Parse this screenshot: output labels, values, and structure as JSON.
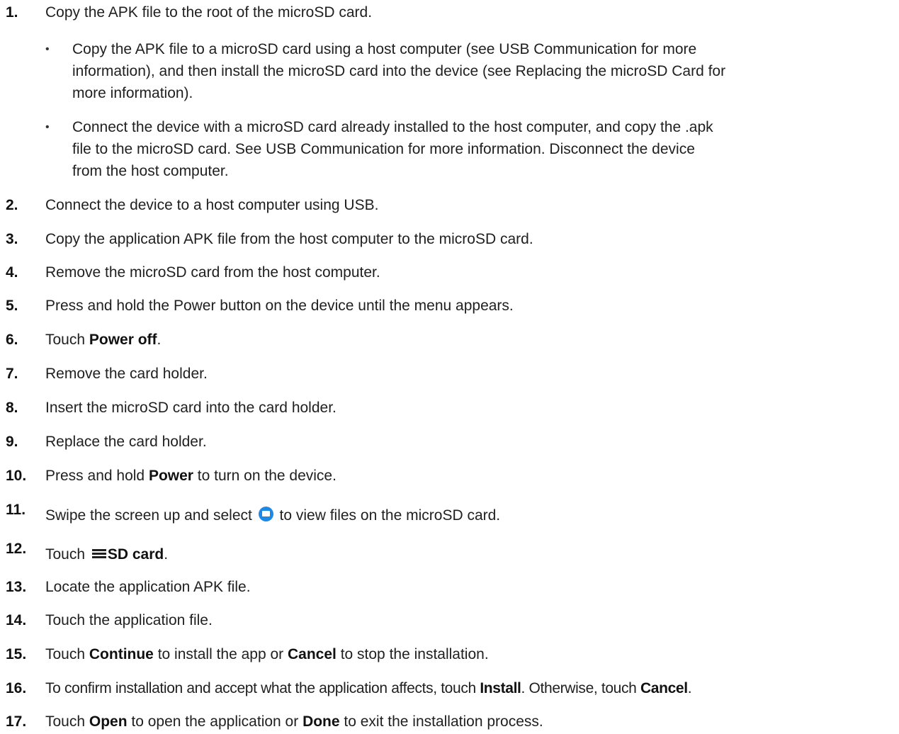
{
  "steps": [
    {
      "num": "1.",
      "parts": [
        {
          "t": "Copy the APK file to the root of the microSD card."
        }
      ]
    },
    {
      "num": "2.",
      "parts": [
        {
          "t": "Connect the device to a host computer using USB."
        }
      ]
    },
    {
      "num": "3.",
      "parts": [
        {
          "t": "Copy the application APK file from the host computer to the microSD card."
        }
      ]
    },
    {
      "num": "4.",
      "parts": [
        {
          "t": "Remove the microSD card from the host computer."
        }
      ]
    },
    {
      "num": "5.",
      "parts": [
        {
          "t": "Press and hold the Power button on the device until the menu appears."
        }
      ]
    },
    {
      "num": "6.",
      "parts": [
        {
          "t": "Touch "
        },
        {
          "b": "Power off"
        },
        {
          "t": "."
        }
      ]
    },
    {
      "num": "7.",
      "parts": [
        {
          "t": "Remove the card holder."
        }
      ]
    },
    {
      "num": "8.",
      "parts": [
        {
          "t": "Insert the microSD card into the card holder."
        }
      ]
    },
    {
      "num": "9.",
      "parts": [
        {
          "t": "Replace the card holder."
        }
      ]
    },
    {
      "num": "10.",
      "parts": [
        {
          "t": "Press and hold "
        },
        {
          "b": "Power"
        },
        {
          "t": " to turn on the device."
        }
      ]
    },
    {
      "num": "11.",
      "parts": [
        {
          "t": "Swipe the screen up and select "
        },
        {
          "icon": "files-app-icon"
        },
        {
          "t": " to view files on the microSD card."
        }
      ]
    },
    {
      "num": "12.",
      "parts": [
        {
          "t": "Touch "
        },
        {
          "icon": "menu-icon"
        },
        {
          "b": "SD card"
        },
        {
          "t": "."
        }
      ]
    },
    {
      "num": "13.",
      "parts": [
        {
          "t": "Locate the application APK file."
        }
      ]
    },
    {
      "num": "14.",
      "parts": [
        {
          "t": "Touch the application file."
        }
      ]
    },
    {
      "num": "15.",
      "parts": [
        {
          "t": "Touch "
        },
        {
          "b": "Continue"
        },
        {
          "t": " to install the app or "
        },
        {
          "b": "Cancel"
        },
        {
          "t": " to stop the installation."
        }
      ]
    },
    {
      "num": "16.",
      "parts": [
        {
          "t": "To confirm installation and accept what the application affects, touch "
        },
        {
          "b": "Install"
        },
        {
          "t": ". Otherwise, touch "
        },
        {
          "b": "Cancel"
        },
        {
          "t": "."
        }
      ]
    },
    {
      "num": "17.",
      "parts": [
        {
          "t": "Touch "
        },
        {
          "b": "Open"
        },
        {
          "t": " to open the application or "
        },
        {
          "b": "Done"
        },
        {
          "t": " to exit the installation process."
        }
      ]
    }
  ],
  "bullets": {
    "marker": "•",
    "items": [
      [
        "Copy the APK file to a microSD card using a host computer (see USB Communication for more",
        "information), and then install the microSD card into the device (see Replacing the microSD Card for",
        "more information)."
      ],
      [
        "Connect the device with a microSD card already installed to the host computer, and copy the .apk",
        "file to the microSD card. See USB Communication for more information. Disconnect the device",
        "from the host computer."
      ]
    ]
  },
  "colors": {
    "text": "#1f1f1f",
    "files_icon": "#1e88e5"
  }
}
